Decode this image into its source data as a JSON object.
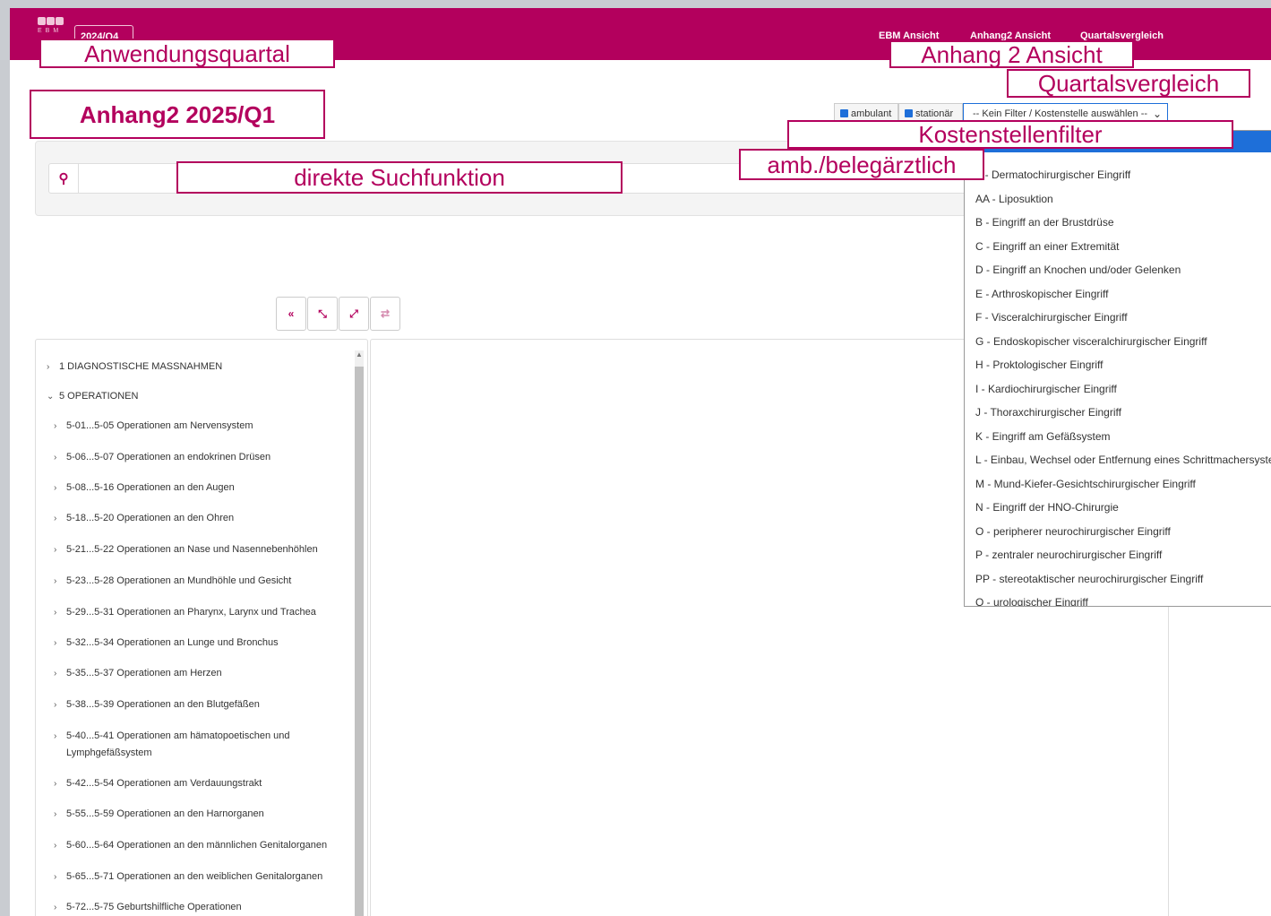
{
  "header": {
    "logo_text": "EBM",
    "quarter": "2024/Q4",
    "nav": [
      "EBM Ansicht",
      "Anhang2 Ansicht",
      "Quartalsvergleich"
    ]
  },
  "annotations": {
    "anwendungsquartal": "Anwendungsquartal",
    "anhang2_ansicht": "Anhang 2 Ansicht",
    "quartalsvergleich": "Quartalsvergleich",
    "title": "Anhang2 2025/Q1",
    "kostenstellenfilter": "Kostenstellenfilter",
    "amb_beleg": "amb./belegärztlich",
    "suchfunktion": "direkte Suchfunktion"
  },
  "filter": {
    "ambulant": "ambulant",
    "stationaer": "stationär",
    "select_placeholder": "-- Kein Filter / Kostenstelle auswählen --"
  },
  "dropdown": {
    "items": [
      "A - Dermatochirurgischer Eingriff",
      "AA - Liposuktion",
      "B - Eingriff an der Brustdrüse",
      "C - Eingriff an einer Extremität",
      "D - Eingriff an Knochen und/oder Gelenken",
      "E - Arthroskopischer Eingriff",
      "F - Visceralchirurgischer Eingriff",
      "G - Endoskopischer visceralchirurgischer Eingriff",
      "H - Proktologischer Eingriff",
      "I - Kardiochirurgischer Eingriff",
      "J - Thoraxchirurgischer Eingriff",
      "K - Eingriff am Gefäßsystem",
      "L - Einbau, Wechsel oder Entfernung eines Schrittmachersystems",
      "M - Mund-Kiefer-Gesichtschirurgischer Eingriff",
      "N - Eingriff der HNO-Chirurgie",
      "O - peripherer neurochirurgischer Eingriff",
      "P - zentraler neurochirurgischer Eingriff",
      "PP - stereotaktischer neurochirurgischer Eingriff",
      "Q - urologischer Eingriff"
    ]
  },
  "tree": {
    "items": [
      "1 DIAGNOSTISCHE MASSNAHMEN",
      "5 OPERATIONEN",
      "5-01...5-05 Operationen am Nervensystem",
      "5-06...5-07 Operationen an endokrinen Drüsen",
      "5-08...5-16 Operationen an den Augen",
      "5-18...5-20 Operationen an den Ohren",
      "5-21...5-22 Operationen an Nase und Nasennebenhöhlen",
      "5-23...5-28 Operationen an Mundhöhle und Gesicht",
      "5-29...5-31 Operationen an Pharynx, Larynx und Trachea",
      "5-32...5-34 Operationen an Lunge und Bronchus",
      "5-35...5-37 Operationen am Herzen",
      "5-38...5-39 Operationen an den Blutgefäßen",
      "5-40...5-41 Operationen am hämatopoetischen und",
      "Lymphgefäßsystem",
      "5-42...5-54 Operationen am Verdauungstrakt",
      "5-55...5-59 Operationen an den Harnorganen",
      "5-60...5-64 Operationen an den männlichen Genitalorganen",
      "5-65...5-71 Operationen an den weiblichen Genitalorganen",
      "5-72...5-75 Geburtshilfliche Operationen"
    ]
  }
}
